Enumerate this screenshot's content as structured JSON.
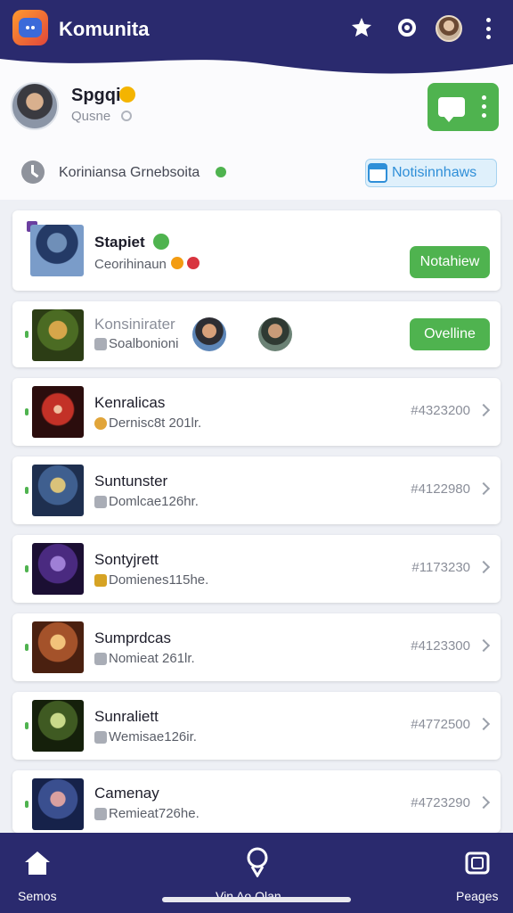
{
  "app": {
    "title": "Komunita"
  },
  "profile": {
    "name": "Spgqi",
    "subtitle": "Qusne",
    "info_text": "Koriniansa Grnebsoita",
    "notification_label": "Notisinnhaws"
  },
  "featured": {
    "title": "Stapiet",
    "subtitle": "Ceorihinaun",
    "button_label": "Notahiew"
  },
  "second": {
    "title": "Konsinirater",
    "subtitle": "Soalbonioni",
    "button_label": "Ovelline"
  },
  "items": [
    {
      "title": "Kenralicas",
      "subtitle": "Dernisc8t 201lr.",
      "number": "#4323200"
    },
    {
      "title": "Suntunster",
      "subtitle": "Domlcae126hr.",
      "number": "#4122980"
    },
    {
      "title": "Sontyjrett",
      "subtitle": "Domienes115he.",
      "number": "#1173230"
    },
    {
      "title": "Sumprdcas",
      "subtitle": "Nomieat 261lr.",
      "number": "#4123300"
    },
    {
      "title": "Sunraliett",
      "subtitle": "Wemisae126ir.",
      "number": "#4772500"
    },
    {
      "title": "Camenay",
      "subtitle": "Remieat726he.",
      "number": "#4723290"
    }
  ],
  "nav": {
    "left_label": "Semos",
    "center_label": "Vin Ao Olan",
    "right_label": "Peages"
  },
  "colors": {
    "primary": "#2a2a6e",
    "green": "#4fb34f",
    "blue": "#2f8fd8"
  }
}
